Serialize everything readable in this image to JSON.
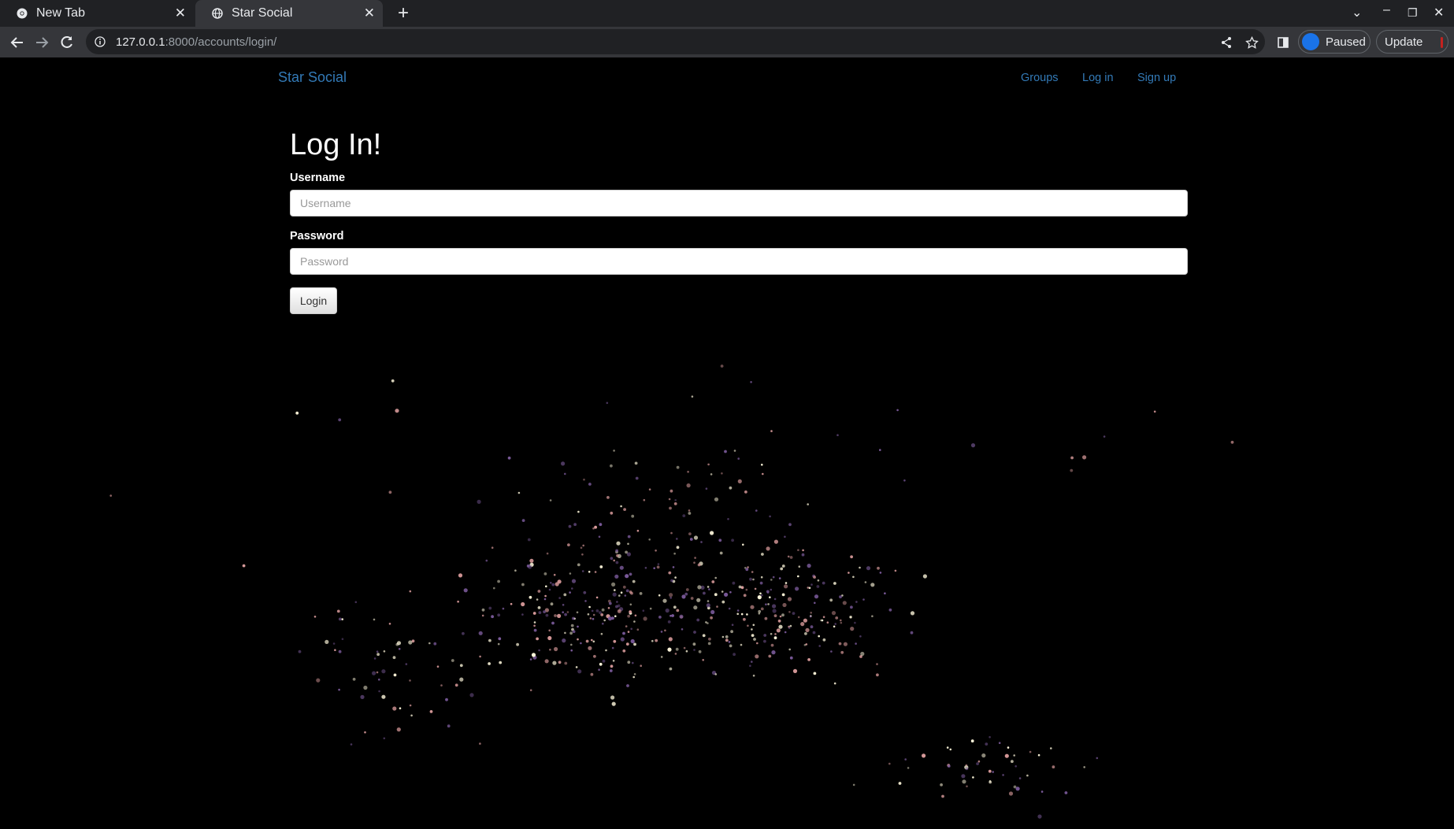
{
  "browser": {
    "tabs": [
      {
        "title": "New Tab"
      },
      {
        "title": "Star Social"
      }
    ],
    "url_host": "127.0.0.1",
    "url_rest": ":8000/accounts/login/",
    "profile_status": "Paused",
    "update_label": "Update"
  },
  "navbar": {
    "brand": "Star Social",
    "links": [
      "Groups",
      "Log in",
      "Sign up"
    ],
    "link_color": "#337ab7"
  },
  "form": {
    "title": "Log In!",
    "username_label": "Username",
    "username_placeholder": "Username",
    "password_label": "Password",
    "password_placeholder": "Password",
    "submit_label": "Login"
  },
  "background": {
    "description_colors": [
      "#fff8dc",
      "#d89a9a",
      "#7a5a9a"
    ]
  }
}
